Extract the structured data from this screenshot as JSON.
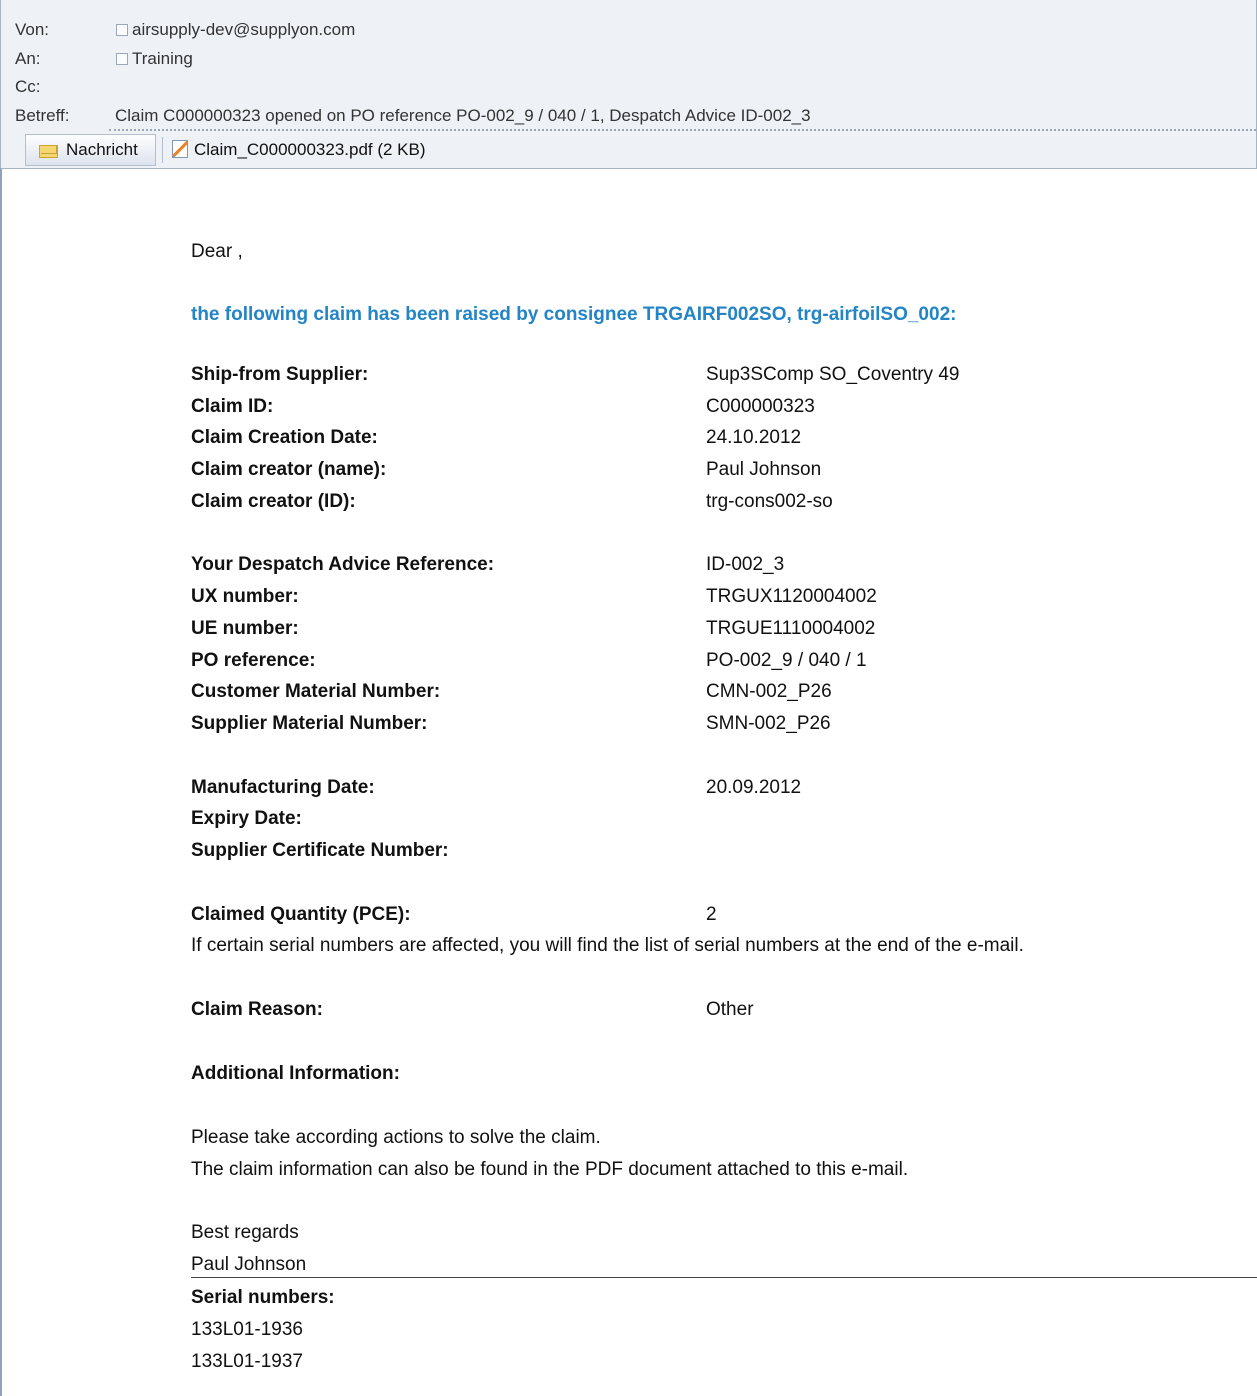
{
  "header": {
    "from_label": "Von:",
    "from_value": "airsupply-dev@supplyon.com",
    "to_label": "An:",
    "to_value": "Training",
    "cc_label": "Cc:",
    "cc_value": "",
    "subject_label": "Betreff:",
    "subject_value": "Claim C000000323 opened on PO reference PO-002_9 / 040 / 1, Despatch Advice ID-002_3"
  },
  "tabs": {
    "message_label": "Nachricht",
    "attachment_label": "Claim_C000000323.pdf (2 KB)"
  },
  "body": {
    "greeting": "Dear ,",
    "intro": "the following claim has been raised by consignee TRGAIRF002SO, trg-airfoilSO_002:",
    "fields": [
      {
        "label": "Ship-from Supplier:",
        "value": "Sup3SComp SO_Coventry 49"
      },
      {
        "label": "Claim ID:",
        "value": "C000000323"
      },
      {
        "label": "Claim Creation Date:",
        "value": "24.10.2012"
      },
      {
        "label": "Claim creator (name):",
        "value": "Paul Johnson"
      },
      {
        "label": "Claim creator (ID):",
        "value": "trg-cons002-so"
      },
      {
        "label": "Your Despatch Advice Reference:",
        "value": "ID-002_3"
      },
      {
        "label": "UX number:",
        "value": "TRGUX1120004002"
      },
      {
        "label": "UE number:",
        "value": "TRGUE1110004002"
      },
      {
        "label": "PO reference:",
        "value": "PO-002_9 / 040 / 1"
      },
      {
        "label": "Customer Material Number:",
        "value": "CMN-002_P26"
      },
      {
        "label": "Supplier Material Number:",
        "value": "SMN-002_P26"
      },
      {
        "label": "Manufacturing Date:",
        "value": "20.09.2012"
      },
      {
        "label": "Expiry Date:",
        "value": ""
      },
      {
        "label": "Supplier Certificate Number:",
        "value": ""
      },
      {
        "label": "Claimed Quantity (PCE):",
        "value": "2"
      },
      {
        "label": "Claim Reason:",
        "value": "Other"
      },
      {
        "label": "Additional Information:",
        "value": ""
      }
    ],
    "serial_note": "If certain serial numbers are affected, you will find the list of serial numbers at the end of the e-mail.",
    "action_line": "Please take according actions to solve the claim.",
    "pdf_line": "The claim information can also be found in the PDF document attached to this e-mail.",
    "closing": "Best regards",
    "signature": "Paul Johnson",
    "serial_heading": "Serial numbers:",
    "serials": [
      "133L01-1936",
      "133L01-1937"
    ]
  }
}
